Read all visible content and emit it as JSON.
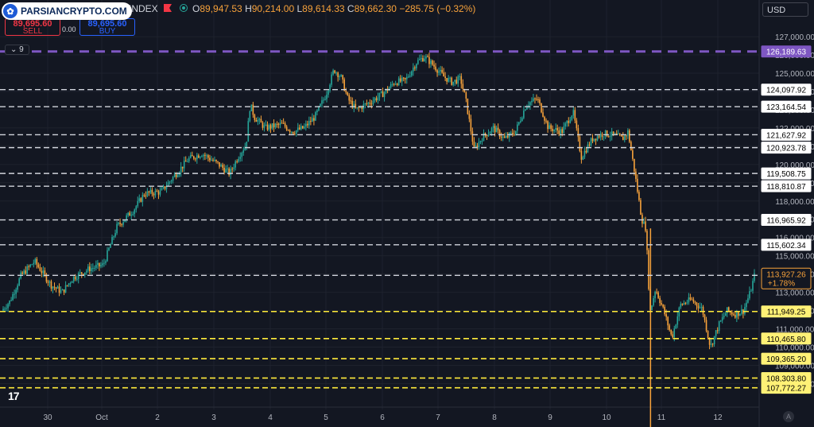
{
  "header": {
    "symbol": "30 · INDEX",
    "ohlc": [
      {
        "k": "O",
        "v": "89,947.53"
      },
      {
        "k": "H",
        "v": "90,214.00"
      },
      {
        "k": "L",
        "v": "89,614.33"
      },
      {
        "k": "C",
        "v": "89,662.30"
      }
    ],
    "change": "−285.75 (−0.32%)"
  },
  "watermark": "PARSIANCRYPTO.COM",
  "trade": {
    "sell_price": "89,695.60",
    "sell_label": "SELL",
    "spread": "0.00",
    "buy_price": "89,695.60",
    "buy_label": "BUY"
  },
  "indicator_toggle": "9",
  "currency": "USD",
  "bottom_right": "A",
  "colors": {
    "background": "#131722",
    "up": "#26a69a",
    "down": "#f7a23b",
    "purple": "#7e57c2",
    "white_level": "#d1d4dc",
    "yellow_level": "#ffeb3b"
  },
  "chart_data": {
    "type": "candlestick",
    "title": "",
    "x_ticks": [
      "30",
      "Oct",
      "2",
      "3",
      "4",
      "5",
      "6",
      "7",
      "8",
      "9",
      "10",
      "11",
      "12"
    ],
    "ylim": [
      106800,
      127700
    ],
    "y_ticks": [
      127000,
      126000,
      125000,
      124000,
      123000,
      122000,
      121000,
      120000,
      119000,
      118000,
      117000,
      116000,
      115000,
      114000,
      113000,
      112000,
      111000,
      110000,
      109000,
      108000
    ],
    "y_tick_labels": [
      "127,000.00",
      "126,000.00",
      "125,000.00",
      "124,000.00",
      "123,000.00",
      "122,000.00",
      "121,000.00",
      "120,000.00",
      "119,000.00",
      "118,000.00",
      "117,000.00",
      "116,000.00",
      "115,000.00",
      "114,000.00",
      "113,000.00",
      "112,000.00",
      "111,000.00",
      "110,000.00",
      "109,000.00",
      "108,000.00"
    ],
    "price_path": [
      [
        0,
        112000
      ],
      [
        0.3,
        112500
      ],
      [
        0.7,
        113900
      ],
      [
        1.2,
        114700
      ],
      [
        1.8,
        113400
      ],
      [
        2.2,
        113000
      ],
      [
        2.6,
        113800
      ],
      [
        3.2,
        114300
      ],
      [
        3.7,
        114500
      ],
      [
        4.2,
        116600
      ],
      [
        4.8,
        117500
      ],
      [
        5.2,
        118400
      ],
      [
        5.8,
        118500
      ],
      [
        6.3,
        119400
      ],
      [
        6.8,
        120300
      ],
      [
        7.3,
        120600
      ],
      [
        7.9,
        120000
      ],
      [
        8.3,
        119500
      ],
      [
        8.6,
        120400
      ],
      [
        8.9,
        121100
      ],
      [
        9.05,
        123300
      ],
      [
        9.2,
        122600
      ],
      [
        9.6,
        122000
      ],
      [
        10.2,
        122200
      ],
      [
        10.6,
        121800
      ],
      [
        11.0,
        122000
      ],
      [
        11.4,
        122600
      ],
      [
        11.8,
        123800
      ],
      [
        12.1,
        125200
      ],
      [
        12.35,
        124800
      ],
      [
        12.6,
        123600
      ],
      [
        12.9,
        123000
      ],
      [
        13.4,
        123400
      ],
      [
        13.9,
        123900
      ],
      [
        14.3,
        124500
      ],
      [
        14.7,
        124600
      ],
      [
        15.1,
        125600
      ],
      [
        15.4,
        125900
      ],
      [
        15.8,
        125300
      ],
      [
        16.1,
        124800
      ],
      [
        16.4,
        124500
      ],
      [
        16.7,
        124700
      ],
      [
        16.9,
        123500
      ],
      [
        17.2,
        120800
      ],
      [
        17.5,
        121500
      ],
      [
        17.9,
        122000
      ],
      [
        18.3,
        121400
      ],
      [
        18.7,
        121800
      ],
      [
        19.1,
        123300
      ],
      [
        19.5,
        123600
      ],
      [
        19.9,
        122000
      ],
      [
        20.4,
        121800
      ],
      [
        20.8,
        122900
      ],
      [
        21.1,
        120400
      ],
      [
        21.5,
        121400
      ],
      [
        21.9,
        121700
      ],
      [
        22.3,
        121600
      ],
      [
        22.6,
        121400
      ],
      [
        22.8,
        121800
      ],
      [
        23.05,
        119500
      ],
      [
        23.3,
        117000
      ],
      [
        23.45,
        116500
      ],
      [
        23.6,
        111900
      ],
      [
        23.8,
        113200
      ],
      [
        24.1,
        112000
      ],
      [
        24.4,
        110500
      ],
      [
        24.7,
        112300
      ],
      [
        25.1,
        112600
      ],
      [
        25.5,
        112100
      ],
      [
        25.8,
        110000
      ],
      [
        26.1,
        111200
      ],
      [
        26.4,
        112000
      ],
      [
        26.7,
        111800
      ],
      [
        27.0,
        112000
      ],
      [
        27.25,
        113000
      ],
      [
        27.4,
        113900
      ]
    ],
    "levels": [
      {
        "value": 126189.63,
        "label": "126,189.63",
        "style": "purple"
      },
      {
        "value": 124097.92,
        "label": "124,097.92",
        "style": "white"
      },
      {
        "value": 123164.54,
        "label": "123,164.54",
        "style": "white"
      },
      {
        "value": 121627.92,
        "label": "121,627.92",
        "style": "white"
      },
      {
        "value": 120923.78,
        "label": "120,923.78",
        "style": "white"
      },
      {
        "value": 119508.75,
        "label": "119,508.75",
        "style": "white"
      },
      {
        "value": 118810.87,
        "label": "118,810.87",
        "style": "white"
      },
      {
        "value": 116965.92,
        "label": "116,965.92",
        "style": "white"
      },
      {
        "value": 115602.34,
        "label": "115,602.34",
        "style": "white"
      },
      {
        "value": 111949.25,
        "label": "111,949.25",
        "style": "yellow"
      },
      {
        "value": 110465.8,
        "label": "110,465.80",
        "style": "yellow"
      },
      {
        "value": 109365.2,
        "label": "109,365.20",
        "style": "yellow"
      },
      {
        "value": 108303.8,
        "label": "108,303.80",
        "style": "yellow"
      },
      {
        "value": 107772.27,
        "label": "107,772.27",
        "style": "yellow"
      }
    ],
    "unlabeled_levels": [
      113927.26
    ],
    "current_price": {
      "value": 113927.26,
      "label": "113,927.26",
      "change": "+1.78%"
    }
  }
}
